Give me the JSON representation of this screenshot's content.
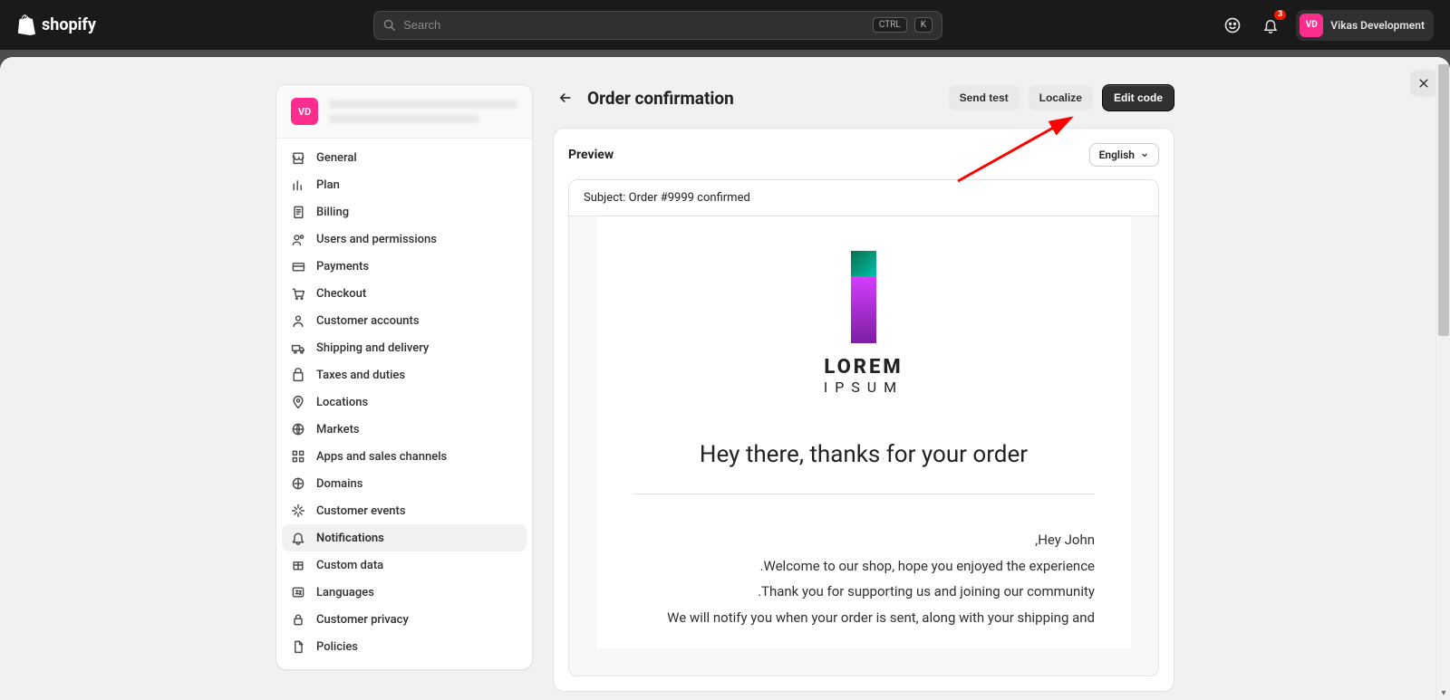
{
  "header": {
    "brand": "shopify",
    "search_placeholder": "Search",
    "kbd1": "CTRL",
    "kbd2": "K",
    "notif_count": "3",
    "avatar_initials": "VD",
    "user_name": "Vikas Development"
  },
  "sidebar": {
    "avatar_initials": "VD",
    "items": [
      {
        "icon": "store",
        "label": "General"
      },
      {
        "icon": "chart",
        "label": "Plan"
      },
      {
        "icon": "receipt",
        "label": "Billing"
      },
      {
        "icon": "users",
        "label": "Users and permissions"
      },
      {
        "icon": "card",
        "label": "Payments"
      },
      {
        "icon": "cart",
        "label": "Checkout"
      },
      {
        "icon": "person",
        "label": "Customer accounts"
      },
      {
        "icon": "truck",
        "label": "Shipping and delivery"
      },
      {
        "icon": "bag",
        "label": "Taxes and duties"
      },
      {
        "icon": "pin",
        "label": "Locations"
      },
      {
        "icon": "globe",
        "label": "Markets"
      },
      {
        "icon": "grid",
        "label": "Apps and sales channels"
      },
      {
        "icon": "domain",
        "label": "Domains"
      },
      {
        "icon": "spark",
        "label": "Customer events"
      },
      {
        "icon": "bell",
        "label": "Notifications",
        "active": true
      },
      {
        "icon": "box",
        "label": "Custom data"
      },
      {
        "icon": "lang",
        "label": "Languages"
      },
      {
        "icon": "lock",
        "label": "Customer privacy"
      },
      {
        "icon": "doc",
        "label": "Policies"
      }
    ]
  },
  "main": {
    "title": "Order confirmation",
    "buttons": {
      "send_test": "Send test",
      "localize": "Localize",
      "edit_code": "Edit code"
    },
    "preview": {
      "heading": "Preview",
      "language": "English",
      "subject_label": "Subject:",
      "subject_value": "Order #9999 confirmed",
      "logo_line1": "LOREM",
      "logo_line2": "IPSUM",
      "greeting": "Hey there, thanks for your order",
      "lines": [
        ",Hey John",
        ".Welcome to our shop, hope you enjoyed the experience",
        ".Thank you for supporting us and joining our community",
        "We will notify you when your order is sent, along with your shipping and"
      ]
    }
  }
}
